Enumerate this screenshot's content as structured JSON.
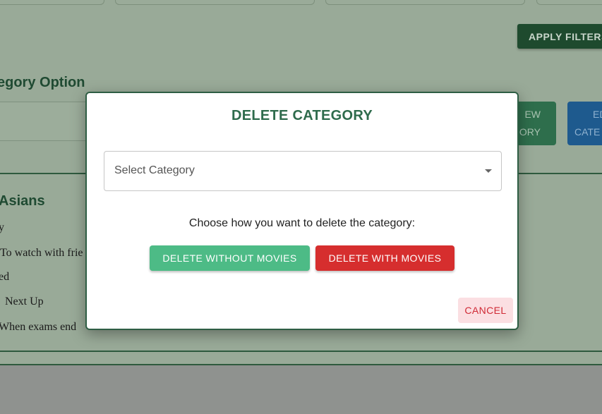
{
  "background": {
    "apply_filters_label": "APPLY FILTERS",
    "section_title": "egory Option",
    "new_category_label_line1": "EW",
    "new_category_label_line2": "ORY",
    "edit_category_label_line1": "ED",
    "edit_category_label_line2": "CATE",
    "list_heading": "Asians",
    "list_items": [
      "y",
      "To watch with frie",
      "ed",
      "Next Up",
      "When exams end"
    ]
  },
  "modal": {
    "title": "DELETE CATEGORY",
    "select_placeholder": "Select Category",
    "prompt": "Choose how you want to delete the category:",
    "delete_without_label": "DELETE WITHOUT MOVIES",
    "delete_with_label": "DELETE WITH MOVIES",
    "cancel_label": "CANCEL"
  },
  "colors": {
    "title_green": "#2e6b4c",
    "delete_without_bg": "#4dbb86",
    "delete_with_bg": "#d62e2e",
    "cancel_text": "#d02a35"
  }
}
